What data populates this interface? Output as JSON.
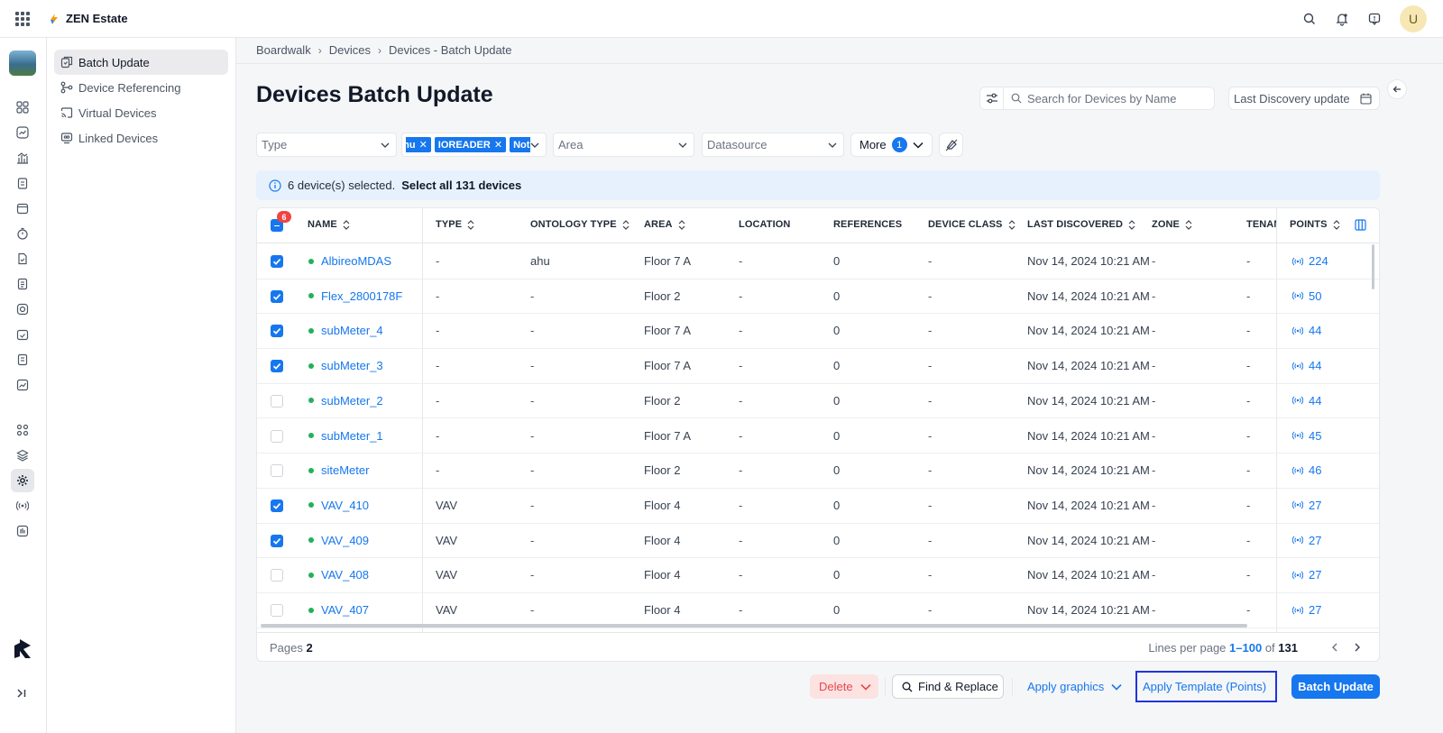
{
  "app": {
    "name": "ZEN Estate",
    "user_initial": "U"
  },
  "subnav": {
    "items": [
      {
        "label": "Batch Update",
        "active": true
      },
      {
        "label": "Device Referencing",
        "active": false
      },
      {
        "label": "Virtual Devices",
        "active": false
      },
      {
        "label": "Linked Devices",
        "active": false
      }
    ]
  },
  "breadcrumb": [
    "Boardwalk",
    "Devices",
    "Devices - Batch Update"
  ],
  "page": {
    "title": "Devices Batch Update"
  },
  "search": {
    "placeholder": "Search for Devices by Name"
  },
  "date_filter": {
    "label": "Last Discovery update"
  },
  "filters": {
    "type_placeholder": "Type",
    "ontology_chips": [
      "ahu",
      "IOREADER",
      "Not"
    ],
    "area_placeholder": "Area",
    "datasource_placeholder": "Datasource",
    "more_label": "More",
    "more_count": "1"
  },
  "selection_banner": {
    "text": "6 device(s) selected.",
    "action": "Select all 131 devices"
  },
  "table": {
    "selected_count": "6",
    "columns": [
      "NAME",
      "TYPE",
      "ONTOLOGY TYPE",
      "AREA",
      "LOCATION",
      "REFERENCES",
      "DEVICE CLASS",
      "LAST DISCOVERED",
      "ZONE",
      "TENAN",
      "POINTS"
    ],
    "rows": [
      {
        "checked": true,
        "name": "AlbireoMDAS",
        "type": "-",
        "ontology": "ahu",
        "area": "Floor 7 A",
        "location": "-",
        "references": "0",
        "device_class": "-",
        "last_discovered": "Nov 14, 2024 10:21 AM",
        "zone": "-",
        "tenant": "-",
        "points": "224"
      },
      {
        "checked": true,
        "name": "Flex_2800178F",
        "type": "-",
        "ontology": "-",
        "area": "Floor 2",
        "location": "-",
        "references": "0",
        "device_class": "-",
        "last_discovered": "Nov 14, 2024 10:21 AM",
        "zone": "-",
        "tenant": "-",
        "points": "50"
      },
      {
        "checked": true,
        "name": "subMeter_4",
        "type": "-",
        "ontology": "-",
        "area": "Floor 7 A",
        "location": "-",
        "references": "0",
        "device_class": "-",
        "last_discovered": "Nov 14, 2024 10:21 AM",
        "zone": "-",
        "tenant": "-",
        "points": "44"
      },
      {
        "checked": true,
        "name": "subMeter_3",
        "type": "-",
        "ontology": "-",
        "area": "Floor 7 A",
        "location": "-",
        "references": "0",
        "device_class": "-",
        "last_discovered": "Nov 14, 2024 10:21 AM",
        "zone": "-",
        "tenant": "-",
        "points": "44"
      },
      {
        "checked": false,
        "name": "subMeter_2",
        "type": "-",
        "ontology": "-",
        "area": "Floor 2",
        "location": "-",
        "references": "0",
        "device_class": "-",
        "last_discovered": "Nov 14, 2024 10:21 AM",
        "zone": "-",
        "tenant": "-",
        "points": "44"
      },
      {
        "checked": false,
        "name": "subMeter_1",
        "type": "-",
        "ontology": "-",
        "area": "Floor 7 A",
        "location": "-",
        "references": "0",
        "device_class": "-",
        "last_discovered": "Nov 14, 2024 10:21 AM",
        "zone": "-",
        "tenant": "-",
        "points": "45"
      },
      {
        "checked": false,
        "name": "siteMeter",
        "type": "-",
        "ontology": "-",
        "area": "Floor 2",
        "location": "-",
        "references": "0",
        "device_class": "-",
        "last_discovered": "Nov 14, 2024 10:21 AM",
        "zone": "-",
        "tenant": "-",
        "points": "46"
      },
      {
        "checked": true,
        "name": "VAV_410",
        "type": "VAV",
        "ontology": "-",
        "area": "Floor 4",
        "location": "-",
        "references": "0",
        "device_class": "-",
        "last_discovered": "Nov 14, 2024 10:21 AM",
        "zone": "-",
        "tenant": "-",
        "points": "27"
      },
      {
        "checked": true,
        "name": "VAV_409",
        "type": "VAV",
        "ontology": "-",
        "area": "Floor 4",
        "location": "-",
        "references": "0",
        "device_class": "-",
        "last_discovered": "Nov 14, 2024 10:21 AM",
        "zone": "-",
        "tenant": "-",
        "points": "27"
      },
      {
        "checked": false,
        "name": "VAV_408",
        "type": "VAV",
        "ontology": "-",
        "area": "Floor 4",
        "location": "-",
        "references": "0",
        "device_class": "-",
        "last_discovered": "Nov 14, 2024 10:21 AM",
        "zone": "-",
        "tenant": "-",
        "points": "27"
      },
      {
        "checked": false,
        "name": "VAV_407",
        "type": "VAV",
        "ontology": "-",
        "area": "Floor 4",
        "location": "-",
        "references": "0",
        "device_class": "-",
        "last_discovered": "Nov 14, 2024 10:21 AM",
        "zone": "-",
        "tenant": "-",
        "points": "27"
      }
    ]
  },
  "footer": {
    "pages_label": "Pages",
    "pages_value": "2",
    "lines_label": "Lines per page",
    "range": "1–100",
    "of_label": "of",
    "total": "131"
  },
  "actions": {
    "delete": "Delete",
    "find_replace": "Find & Replace",
    "apply_graphics": "Apply graphics",
    "apply_template": "Apply Template (Points)",
    "batch_update": "Batch Update"
  },
  "colors": {
    "accent": "#1677ee",
    "danger": "#e5484d",
    "status_online": "#22b05a"
  }
}
